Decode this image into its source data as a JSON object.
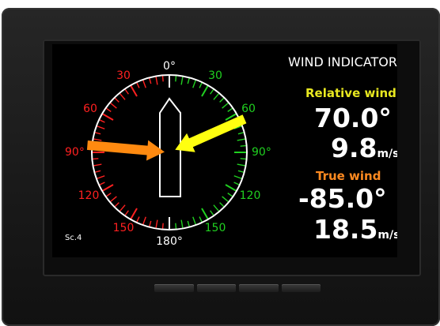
{
  "display": {
    "title": "WIND INDICATOR",
    "screen_id": "Sc.4"
  },
  "relative_wind": {
    "label": "Relative wind",
    "direction": "70.0°",
    "speed_value": "9.8",
    "speed_unit": "m/s"
  },
  "true_wind": {
    "label": "True wind",
    "direction": "-85.0°",
    "speed_value": "18.5",
    "speed_unit": "m/s"
  },
  "compass": {
    "labels": {
      "top": "0°",
      "bottom": "180°",
      "left": "90°",
      "right": "90°",
      "port_30": "30",
      "port_60": "60",
      "port_120": "120",
      "port_150": "150",
      "stbd_30": "30",
      "stbd_60": "60",
      "stbd_120": "120",
      "stbd_150": "150"
    }
  },
  "colors": {
    "port": "#ff2020",
    "starboard": "#20d020",
    "relative_arrow": "#ffff10",
    "true_arrow": "#ff8a10",
    "relative_label": "#e8e820",
    "true_label": "#ff8a20"
  },
  "icons": [
    "vessel-outline-icon",
    "relative-wind-arrow-icon",
    "true-wind-arrow-icon"
  ]
}
